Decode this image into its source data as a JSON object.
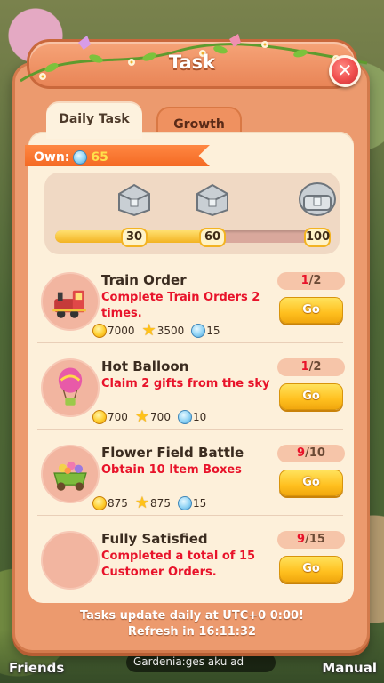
{
  "window": {
    "title": "Task"
  },
  "tabs": [
    {
      "label": "Daily Task",
      "active": true
    },
    {
      "label": "Growth",
      "active": false
    }
  ],
  "own": {
    "label": "Own:",
    "value": "65"
  },
  "progress": {
    "current_fraction": 0.62,
    "milestones": [
      "30",
      "60",
      "100"
    ]
  },
  "tasks": [
    {
      "name": "Train Order",
      "desc": "Complete Train Orders 2 times.",
      "done": "1",
      "total": "/2",
      "rewards": {
        "coin": "7000",
        "star": "3500",
        "gem": "15"
      },
      "go_label": "Go",
      "icon": "train-icon"
    },
    {
      "name": "Hot Balloon",
      "desc": "Claim 2 gifts from the sky",
      "done": "1",
      "total": "/2",
      "rewards": {
        "coin": "700",
        "star": "700",
        "gem": "10"
      },
      "go_label": "Go",
      "icon": "hot-balloon-icon"
    },
    {
      "name": "Flower Field Battle",
      "desc": "Obtain 10 Item Boxes",
      "done": "9",
      "total": "/10",
      "rewards": {
        "coin": "875",
        "star": "875",
        "gem": "15"
      },
      "go_label": "Go",
      "icon": "flower-cart-icon"
    },
    {
      "name": "Fully Satisfied",
      "desc": "Completed a total of 15 Customer Orders.",
      "done": "9",
      "total": "/15",
      "go_label": "Go",
      "icon": "blank-avatar"
    }
  ],
  "footer": {
    "line1": "Tasks update daily at UTC+0 0:00!",
    "line2": "Refresh in 16:11:32"
  },
  "background": {
    "friends": "Friends",
    "manual": "Manual",
    "chat": "Gardenia:ges aku ad"
  },
  "colors": {
    "panel": "#ec9a6e",
    "content": "#fdf0da",
    "accent_red": "#e8132a",
    "go_button": "#ffc01f"
  }
}
